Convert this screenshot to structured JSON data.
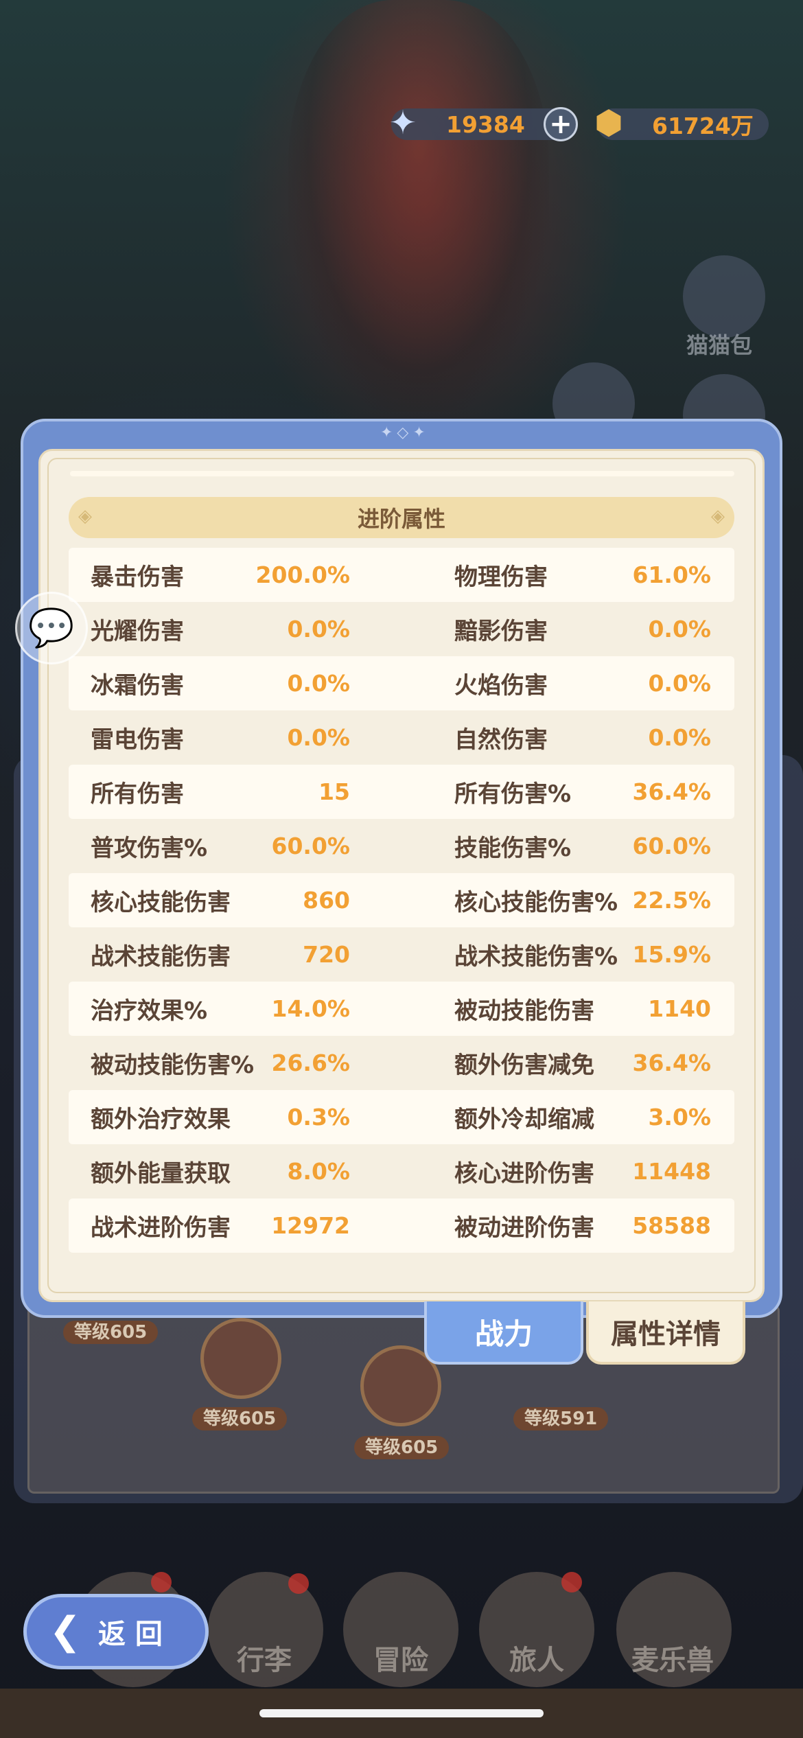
{
  "currency": {
    "gem": {
      "icon": "gem-icon",
      "value": "19384"
    },
    "gold": {
      "icon": "gold-coin-icon",
      "value": "61724万"
    }
  },
  "side": {
    "cat_bag_label": "猫猫包"
  },
  "panel": {
    "section_title": "进阶属性",
    "rows": [
      {
        "l_label": "暴击伤害",
        "l_value": "200.0%",
        "r_label": "物理伤害",
        "r_value": "61.0%"
      },
      {
        "l_label": "光耀伤害",
        "l_value": "0.0%",
        "r_label": "黯影伤害",
        "r_value": "0.0%"
      },
      {
        "l_label": "冰霜伤害",
        "l_value": "0.0%",
        "r_label": "火焰伤害",
        "r_value": "0.0%"
      },
      {
        "l_label": "雷电伤害",
        "l_value": "0.0%",
        "r_label": "自然伤害",
        "r_value": "0.0%"
      },
      {
        "l_label": "所有伤害",
        "l_value": "15",
        "r_label": "所有伤害%",
        "r_value": "36.4%"
      },
      {
        "l_label": "普攻伤害%",
        "l_value": "60.0%",
        "r_label": "技能伤害%",
        "r_value": "60.0%"
      },
      {
        "l_label": "核心技能伤害",
        "l_value": "860",
        "r_label": "核心技能伤害%",
        "r_value": "22.5%"
      },
      {
        "l_label": "战术技能伤害",
        "l_value": "720",
        "r_label": "战术技能伤害%",
        "r_value": "15.9%"
      },
      {
        "l_label": "治疗效果%",
        "l_value": "14.0%",
        "r_label": "被动技能伤害",
        "r_value": "1140"
      },
      {
        "l_label": "被动技能伤害%",
        "l_value": "26.6%",
        "r_label": "额外伤害减免",
        "r_value": "36.4%"
      },
      {
        "l_label": "额外治疗效果",
        "l_value": "0.3%",
        "r_label": "额外冷却缩减",
        "r_value": "3.0%"
      },
      {
        "l_label": "额外能量获取",
        "l_value": "8.0%",
        "r_label": "核心进阶伤害",
        "r_value": "11448"
      },
      {
        "l_label": "战术进阶伤害",
        "l_value": "12972",
        "r_label": "被动进阶伤害",
        "r_value": "58588"
      }
    ]
  },
  "tabs": {
    "power": "战力",
    "attr_detail": "属性详情"
  },
  "levels": {
    "a": "等级605",
    "b": "等级605",
    "c": "等级605",
    "d": "等级591"
  },
  "nav": {
    "luggage": "行李",
    "adventure": "冒险",
    "traveler": "旅人",
    "mailer_beast": "麦乐兽"
  },
  "back": {
    "label": "返 回"
  }
}
